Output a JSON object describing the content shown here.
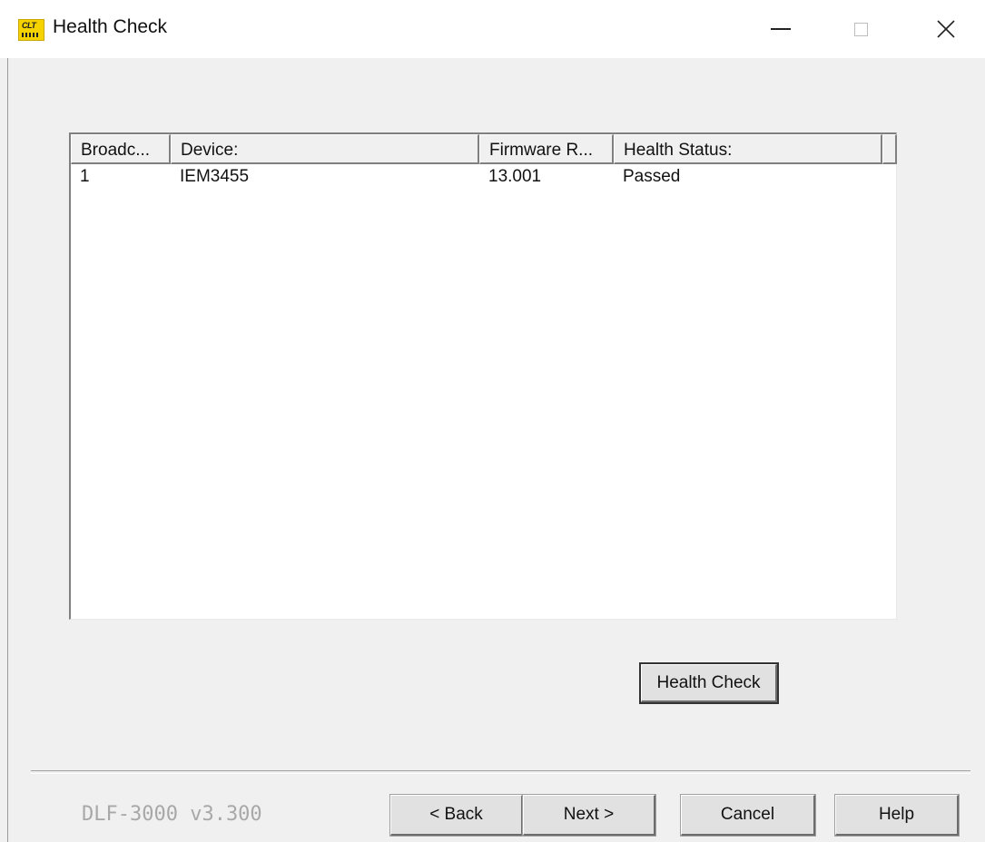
{
  "window": {
    "title": "Health Check",
    "icon": "app-logo-icon"
  },
  "list": {
    "columns": [
      "Broadc...",
      "Device:",
      "Firmware R...",
      "Health Status:"
    ],
    "rows": [
      {
        "broadcast": "1",
        "device": "IEM3455",
        "firmware": "13.001",
        "status": "Passed"
      }
    ]
  },
  "buttons": {
    "health_check": "Health Check",
    "back": "< Back",
    "next": "Next >",
    "cancel": "Cancel",
    "help": "Help"
  },
  "footer": {
    "version": "DLF-3000 v3.300"
  }
}
